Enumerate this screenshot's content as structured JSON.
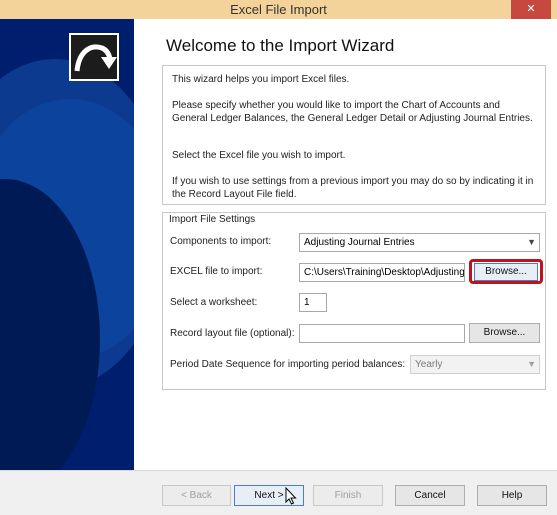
{
  "window": {
    "title": "Excel File Import",
    "close_label": "✕"
  },
  "wizard": {
    "heading": "Welcome to the Import Wizard",
    "intro": [
      "This wizard helps you import Excel files.",
      "Please specify whether you would like to import the Chart of Accounts and General Ledger Balances, the General Ledger Detail or Adjusting Journal Entries.",
      "Select the Excel file you wish to import.",
      "If you wish to use settings from a previous import you may do so by indicating it in the Record Layout File field."
    ]
  },
  "settings": {
    "legend": "Import File Settings",
    "components_label": "Components to import:",
    "components_value": "Adjusting Journal Entries",
    "excel_label": "EXCEL file to import:",
    "excel_value": "C:\\Users\\Training\\Desktop\\Adjusting",
    "browse_label": "Browse...",
    "worksheet_label": "Select a worksheet:",
    "worksheet_value": "1",
    "layout_label": "Record layout file (optional):",
    "layout_value": "",
    "layout_browse_label": "Browse...",
    "period_label": "Period Date Sequence for importing period balances:",
    "period_value": "Yearly"
  },
  "footer": {
    "back_label": "< Back",
    "next_label": "Next >",
    "finish_label": "Finish",
    "cancel_label": "Cancel",
    "help_label": "Help"
  },
  "colors": {
    "highlight": "#c0121c",
    "sidepanel": "#001e6e",
    "titlebar": "#f4d39a"
  }
}
